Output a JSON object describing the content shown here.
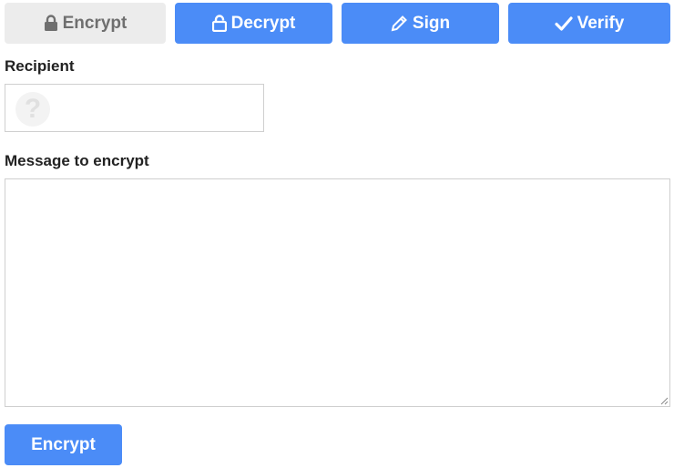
{
  "tabs": [
    {
      "id": "encrypt",
      "label": "Encrypt",
      "icon": "lock-icon",
      "active": true
    },
    {
      "id": "decrypt",
      "label": "Decrypt",
      "icon": "unlock-icon",
      "active": false
    },
    {
      "id": "sign",
      "label": "Sign",
      "icon": "pencil-icon",
      "active": false
    },
    {
      "id": "verify",
      "label": "Verify",
      "icon": "check-icon",
      "active": false
    }
  ],
  "recipient": {
    "label": "Recipient",
    "value": "",
    "avatar_icon": "question-mark-avatar-icon",
    "avatar_glyph": "?"
  },
  "message": {
    "label": "Message to encrypt",
    "value": ""
  },
  "submit": {
    "label": "Encrypt"
  },
  "colors": {
    "accent": "#4b8cf7",
    "tab_active_bg": "#ececec",
    "tab_active_text": "#6f6f6f",
    "label_text": "#222222"
  }
}
